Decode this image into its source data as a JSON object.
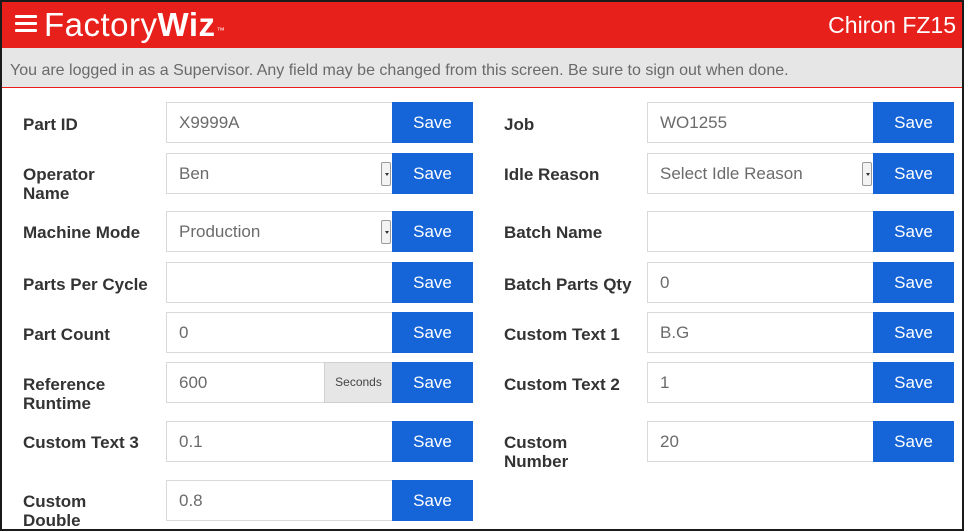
{
  "header": {
    "brand_part1": "Factory",
    "brand_part2": "Wiz",
    "trademark": "™",
    "machine_name": "Chiron FZ15"
  },
  "notice": "You are logged in as a Supervisor. Any field may be changed from this screen. Be sure to sign out when done.",
  "save_label": "Save",
  "fields": {
    "part_id": {
      "label": "Part ID",
      "value": "X9999A",
      "placeholder": ""
    },
    "job": {
      "label": "Job",
      "value": "WO1255",
      "placeholder": ""
    },
    "operator_name": {
      "label_line1": "Operator",
      "label_line2": "Name",
      "value": "Ben"
    },
    "idle_reason": {
      "label": "Idle Reason",
      "value": "Select Idle Reason"
    },
    "machine_mode": {
      "label": "Machine Mode",
      "value": "Production"
    },
    "batch_name": {
      "label": "Batch Name",
      "value": ""
    },
    "parts_per_cycle": {
      "label": "Parts Per Cycle",
      "value": ""
    },
    "batch_parts_qty": {
      "label": "Batch Parts Qty",
      "value": "0"
    },
    "part_count": {
      "label": "Part Count",
      "value": "0"
    },
    "custom_text_1": {
      "label": "Custom Text 1",
      "value": "B.G"
    },
    "reference_runtime": {
      "label_line1": "Reference",
      "label_line2": "Runtime",
      "value": "600",
      "unit": "Seconds"
    },
    "custom_text_2": {
      "label": "Custom Text 2",
      "value": "1"
    },
    "custom_text_3": {
      "label": "Custom Text 3",
      "value": "0.1"
    },
    "custom_number": {
      "label_line1": "Custom",
      "label_line2": "Number",
      "value": "20"
    },
    "custom_double": {
      "label_line1": "Custom",
      "label_line2": "Double",
      "value": "0.8"
    }
  }
}
